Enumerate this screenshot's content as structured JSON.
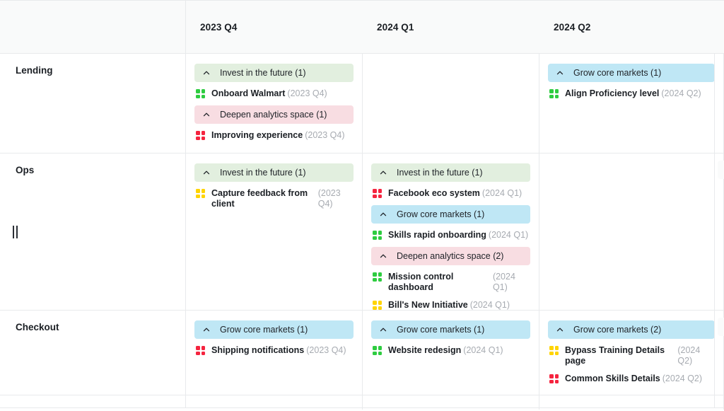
{
  "board": {
    "type": "roadmap-grid",
    "row_label_header": "",
    "columns": [
      {
        "id": "2023-q4",
        "label": "2023 Q4"
      },
      {
        "id": "2024-q1",
        "label": "2024 Q1"
      },
      {
        "id": "2024-q2",
        "label": "2024 Q2"
      }
    ],
    "group_colors": {
      "invest-in-the-future": "#e2efdf",
      "grow-core-markets": "#bfe7f5",
      "deepen-analytics-space": "#f8dde2"
    },
    "status_colors": {
      "green": "#2ecc40",
      "yellow": "#ffd400",
      "red": "#f5243f"
    },
    "rows": [
      {
        "id": "lending",
        "label": "Lending",
        "cells": [
          {
            "column": "2023 Q4",
            "groups": [
              {
                "title": "Invest in the future (1)",
                "color": "green",
                "collapse_icon": "chevron-up-icon",
                "items": [
                  {
                    "name": "Onboard Walmart",
                    "quarter": "(2023 Q4)",
                    "status": "green"
                  }
                ]
              },
              {
                "title": "Deepen analytics space (1)",
                "color": "pink",
                "collapse_icon": "chevron-up-icon",
                "items": [
                  {
                    "name": "Improving experience",
                    "quarter": "(2023 Q4)",
                    "status": "red"
                  }
                ]
              }
            ]
          },
          {
            "column": "2024 Q1",
            "groups": []
          },
          {
            "column": "2024 Q2",
            "groups": [
              {
                "title": "Grow core markets (1)",
                "color": "blue",
                "collapse_icon": "chevron-up-icon",
                "items": [
                  {
                    "name": "Align Proficiency level",
                    "quarter": "(2024 Q2)",
                    "status": "green"
                  }
                ]
              }
            ]
          }
        ]
      },
      {
        "id": "ops",
        "label": "Ops",
        "drag_handle": "row-drag-handle",
        "cells": [
          {
            "column": "2023 Q4",
            "groups": [
              {
                "title": "Invest in the future (1)",
                "color": "green",
                "collapse_icon": "chevron-up-icon",
                "items": [
                  {
                    "name": "Capture feedback from client",
                    "quarter": "(2023 Q4)",
                    "status": "yellow"
                  }
                ]
              }
            ]
          },
          {
            "column": "2024 Q1",
            "groups": [
              {
                "title": "Invest in the future (1)",
                "color": "green",
                "collapse_icon": "chevron-up-icon",
                "items": [
                  {
                    "name": "Facebook eco system",
                    "quarter": "(2024 Q1)",
                    "status": "red"
                  }
                ]
              },
              {
                "title": "Grow core markets (1)",
                "color": "blue",
                "collapse_icon": "chevron-up-icon",
                "items": [
                  {
                    "name": "Skills rapid onboarding",
                    "quarter": "(2024 Q1)",
                    "status": "green"
                  }
                ]
              },
              {
                "title": "Deepen analytics space (2)",
                "color": "pink",
                "collapse_icon": "chevron-up-icon",
                "items": [
                  {
                    "name": "Mission control dashboard",
                    "quarter": "(2024 Q1)",
                    "status": "green"
                  },
                  {
                    "name": "Bill's New Initiative",
                    "quarter": "(2024 Q1)",
                    "status": "yellow"
                  }
                ]
              }
            ]
          },
          {
            "column": "2024 Q2",
            "groups": []
          }
        ]
      },
      {
        "id": "checkout",
        "label": "Checkout",
        "cells": [
          {
            "column": "2023 Q4",
            "groups": [
              {
                "title": "Grow core markets (1)",
                "color": "blue",
                "collapse_icon": "chevron-up-icon",
                "items": [
                  {
                    "name": "Shipping notifications",
                    "quarter": "(2023 Q4)",
                    "status": "red"
                  }
                ]
              }
            ]
          },
          {
            "column": "2024 Q1",
            "groups": [
              {
                "title": "Grow core markets (1)",
                "color": "blue",
                "collapse_icon": "chevron-up-icon",
                "items": [
                  {
                    "name": "Website redesign",
                    "quarter": "(2024 Q1)",
                    "status": "green"
                  }
                ]
              }
            ]
          },
          {
            "column": "2024 Q2",
            "groups": [
              {
                "title": "Grow core markets (2)",
                "color": "blue",
                "collapse_icon": "chevron-up-icon",
                "items": [
                  {
                    "name": "Bypass Training Details page",
                    "quarter": "(2024 Q2)",
                    "status": "yellow"
                  },
                  {
                    "name": "Common Skills Details",
                    "quarter": "(2024 Q2)",
                    "status": "red"
                  }
                ]
              }
            ]
          }
        ]
      }
    ]
  }
}
